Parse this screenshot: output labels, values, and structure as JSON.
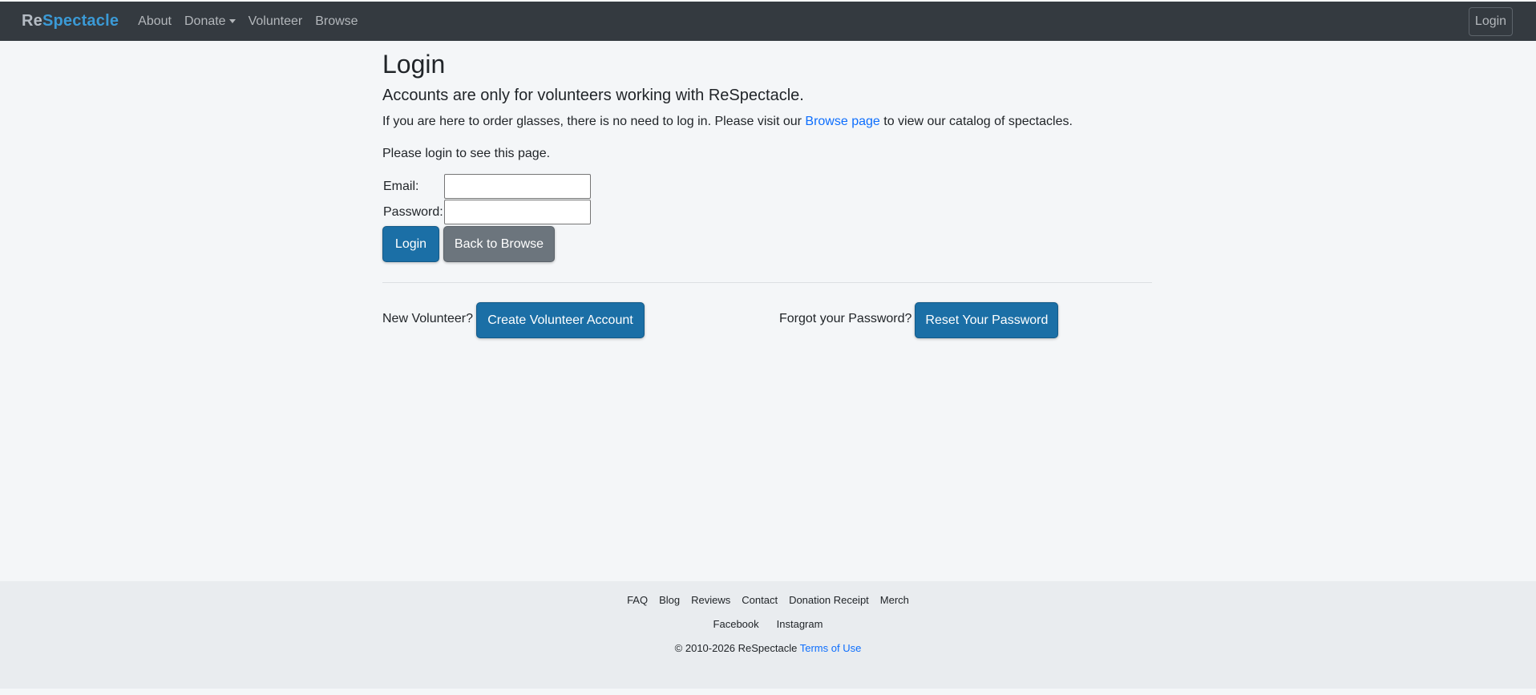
{
  "navbar": {
    "brand_prefix": "Re",
    "brand_suffix": "Spectacle",
    "links": {
      "about": "About",
      "donate": "Donate",
      "volunteer": "Volunteer",
      "browse": "Browse"
    },
    "login_label": "Login"
  },
  "main": {
    "title": "Login",
    "subtitle": "Accounts are only for volunteers working with ReSpectacle.",
    "info_before": "If you are here to order glasses, there is no need to log in. Please visit our ",
    "info_link": "Browse page",
    "info_after": " to view our catalog of spectacles.",
    "prompt": "Please login to see this page.",
    "form": {
      "email_label": "Email:",
      "email_value": "",
      "password_label": "Password:",
      "password_value": "",
      "login_button": "Login",
      "back_button": "Back to Browse"
    },
    "new_volunteer_text": "New Volunteer?",
    "create_account_button": "Create Volunteer Account",
    "forgot_text": "Forgot your Password?",
    "reset_button": "Reset Your Password"
  },
  "footer": {
    "links": [
      "FAQ",
      "Blog",
      "Reviews",
      "Contact",
      "Donation Receipt",
      "Merch"
    ],
    "social": [
      "Facebook",
      "Instagram"
    ],
    "copyright": "© 2010-2026 ReSpectacle ",
    "terms": "Terms of Use"
  },
  "colors": {
    "navbar_bg": "#343a40",
    "brand_accent": "#3b9ad6",
    "primary_button": "#1b6fa6",
    "secondary_button": "#6c757d",
    "link": "#0d6efd"
  }
}
